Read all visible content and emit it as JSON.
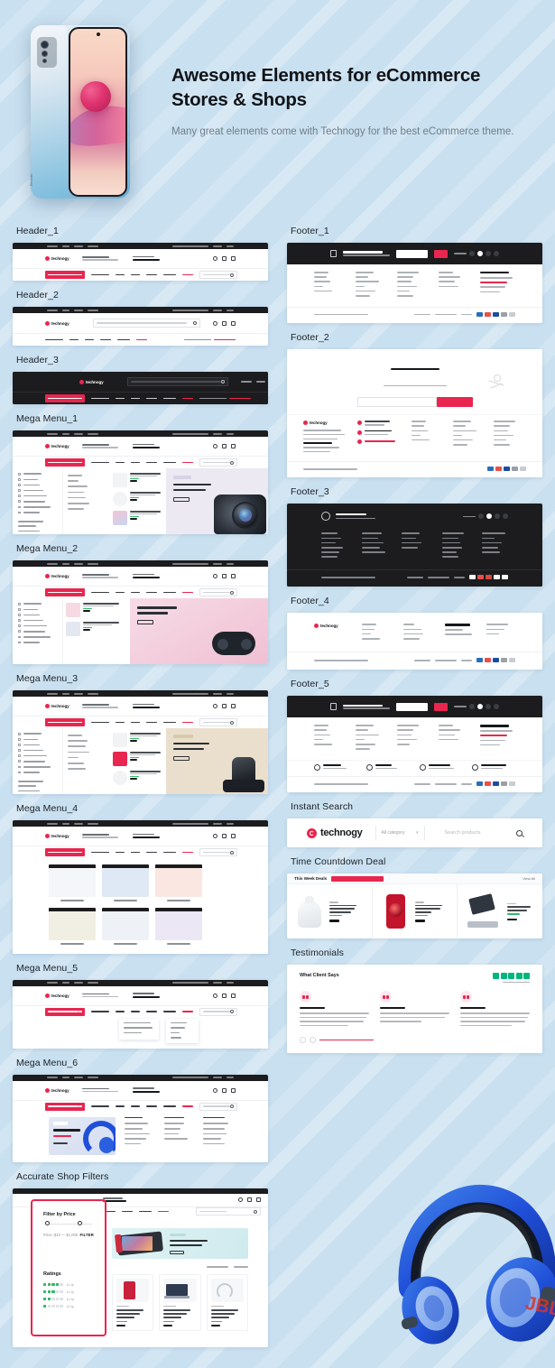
{
  "hero": {
    "title": "Awesome Elements for eCommerce Stores & Shops",
    "subtitle": "Many great elements come with Technogy for the best eCommerce theme.",
    "phone_brand": "Redmi"
  },
  "left_column": [
    {
      "label": "Header_1",
      "kind": "header"
    },
    {
      "label": "Header_2",
      "kind": "header2"
    },
    {
      "label": "Header_3",
      "kind": "header3"
    },
    {
      "label": "Mega Menu_1",
      "kind": "mega1"
    },
    {
      "label": "Mega Menu_2",
      "kind": "mega2"
    },
    {
      "label": "Mega Menu_3",
      "kind": "mega3"
    },
    {
      "label": "Mega Menu_4",
      "kind": "mega4"
    },
    {
      "label": "Mega Menu_5",
      "kind": "mega5"
    },
    {
      "label": "Mega Menu_6",
      "kind": "mega6"
    },
    {
      "label": "Accurate Shop Filters",
      "kind": "filters"
    }
  ],
  "right_column": [
    {
      "label": "Footer_1",
      "kind": "footer1"
    },
    {
      "label": "Footer_2",
      "kind": "footer2"
    },
    {
      "label": "Footer_3",
      "kind": "footer3"
    },
    {
      "label": "Footer_4",
      "kind": "footer4"
    },
    {
      "label": "Footer_5",
      "kind": "footer5"
    },
    {
      "label": "Instant Search",
      "kind": "instant_search"
    },
    {
      "label": "Time Countdown Deal",
      "kind": "countdown"
    },
    {
      "label": "Testimonials",
      "kind": "testimonials"
    }
  ],
  "instant_search": {
    "brand": "technogy",
    "category_label": "All category",
    "search_placeholder": "Search products",
    "search_icon": "search-icon"
  },
  "countdown": {
    "title": "This Week Deals",
    "view_all": "View All",
    "badge_text": ""
  },
  "testimonials": {
    "heading": "What Client Says",
    "rating_icon": "trustpilot-stars"
  },
  "filters": {
    "price_heading": "Filter by Price",
    "price_range": "Price: $10 — $1,000",
    "filter_button": "FILTER",
    "ratings_heading": "Ratings",
    "rating_rows": [
      {
        "filled": 4,
        "label": "& Up"
      },
      {
        "filled": 3,
        "label": "& Up"
      },
      {
        "filled": 2,
        "label": "& Up"
      },
      {
        "filled": 1,
        "label": "& Up"
      }
    ]
  },
  "colors": {
    "background": "#c9e0f0",
    "accent": "#e8264f",
    "dark": "#1c1c1e",
    "text": "#15181c",
    "muted": "#6f7d89",
    "green": "#35b86b"
  }
}
